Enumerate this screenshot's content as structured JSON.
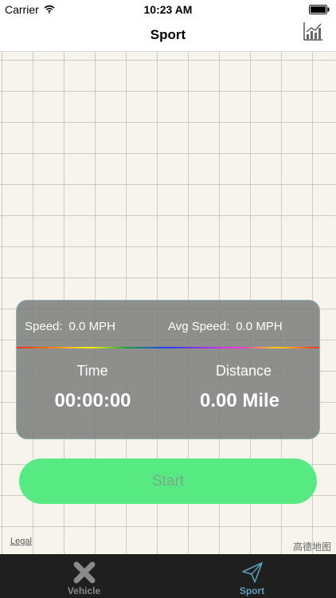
{
  "status_bar": {
    "carrier": "Carrier",
    "time": "10:23 AM"
  },
  "nav": {
    "title": "Sport",
    "right_icon": "chart-icon"
  },
  "stats": {
    "speed_label": "Speed:",
    "speed_value": "0.0 MPH",
    "avg_speed_label": "Avg Speed:",
    "avg_speed_value": "0.0 MPH",
    "time_label": "Time",
    "time_value": "00:00:00",
    "distance_label": "Distance",
    "distance_value": "0.00 Mile"
  },
  "start_label": "Start",
  "map": {
    "legal": "Legal",
    "logo": "高德地图"
  },
  "tabs": [
    {
      "label": "Vehicle",
      "icon": "vehicle-icon",
      "active": false
    },
    {
      "label": "Sport",
      "icon": "sport-icon",
      "active": true
    }
  ],
  "colors": {
    "accent_green": "#58ea82",
    "active_tab": "#5ba0b7",
    "inactive_tab": "#8a8a8a",
    "panel": "#808080",
    "tab_bar": "#1f1f1f"
  }
}
